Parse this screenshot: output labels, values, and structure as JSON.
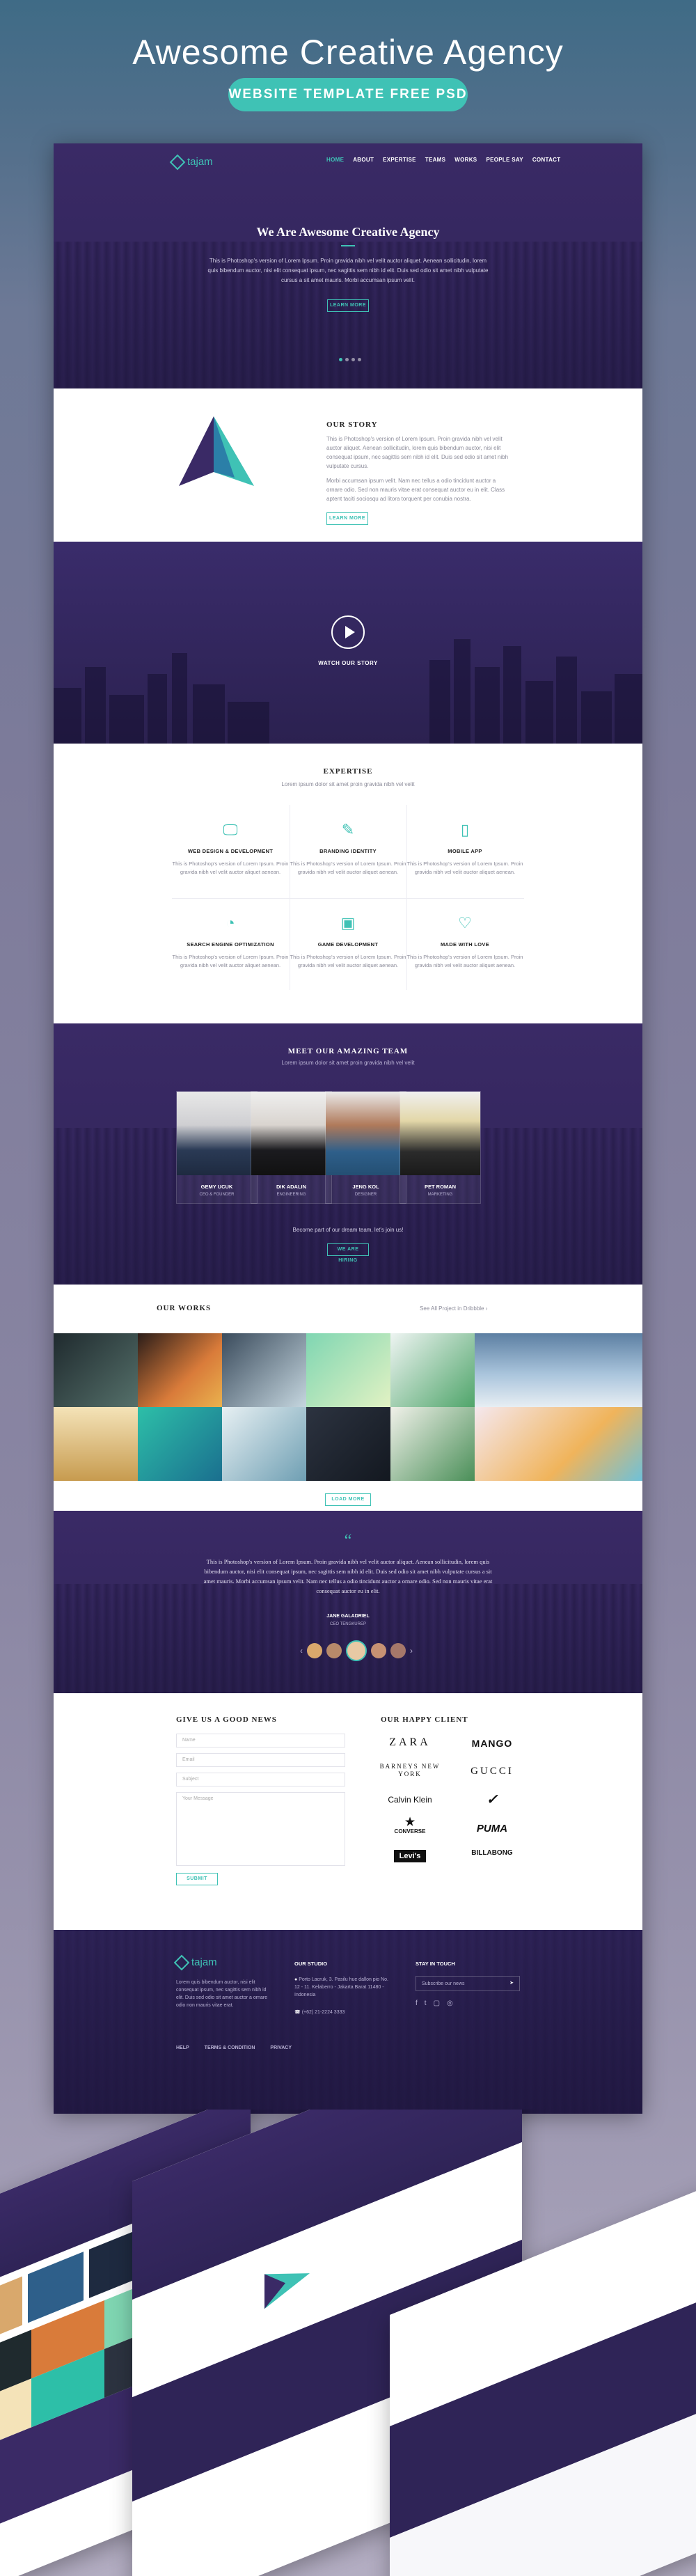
{
  "poster": {
    "title": "Awesome Creative Agency",
    "subtitle": "WEBSITE TEMPLATE FREE PSD"
  },
  "nav": {
    "logo": "tajam",
    "items": [
      "HOME",
      "ABOUT",
      "EXPERTISE",
      "TEAMS",
      "WORKS",
      "PEOPLE SAY",
      "CONTACT"
    ]
  },
  "hero": {
    "title": "We Are Awesome Creative Agency",
    "text": "This is Photoshop's version of Lorem Ipsum. Proin gravida nibh vel velit auctor aliquet. Aenean sollicitudin, lorem quis bibendum auctor, nisi elit consequat ipsum, nec sagittis sem nibh id elit. Duis sed odio sit amet nibh vulputate cursus a sit amet mauris. Morbi accumsan ipsum velit.",
    "button": "LEARN MORE"
  },
  "story": {
    "title": "OUR STORY",
    "p1": "This is Photoshop's version of Lorem Ipsum. Proin gravida nibh vel velit auctor aliquet. Aenean sollicitudin, lorem quis bibendum auctor, nisi elit consequat ipsum, nec sagittis sem nibh id elit. Duis sed odio sit amet nibh vulputate cursus.",
    "p2": "Morbi accumsan ipsum velit. Nam nec tellus a odio tincidunt auctor a ornare odio. Sed non mauris vitae erat consequat auctor eu in elit. Class aptent taciti sociosqu ad litora torquent per conubia nostra.",
    "button": "LEARN MORE"
  },
  "video": {
    "label": "WATCH OUR STORY"
  },
  "expertise": {
    "title": "EXPERTISE",
    "subtitle": "Lorem ipsum dolor sit amet proin gravida nibh vel velit",
    "items": [
      {
        "icon": "monitor-icon",
        "title": "WEB DESIGN & DEVELOPMENT",
        "text": "This is Photoshop's version of Lorem Ipsum. Proin gravida nibh vel velit auctor aliquet aenean."
      },
      {
        "icon": "brush-icon",
        "title": "BRANDING IDENTITY",
        "text": "This is Photoshop's version of Lorem Ipsum. Proin gravida nibh vel velit auctor aliquet aenean."
      },
      {
        "icon": "phone-icon",
        "title": "MOBILE APP",
        "text": "This is Photoshop's version of Lorem Ipsum. Proin gravida nibh vel velit auctor aliquet aenean."
      },
      {
        "icon": "pie-chart-icon",
        "title": "SEARCH ENGINE OPTIMIZATION",
        "text": "This is Photoshop's version of Lorem Ipsum. Proin gravida nibh vel velit auctor aliquet aenean."
      },
      {
        "icon": "gamepad-icon",
        "title": "GAME DEVELOPMENT",
        "text": "This is Photoshop's version of Lorem Ipsum. Proin gravida nibh vel velit auctor aliquet aenean."
      },
      {
        "icon": "heart-icon",
        "title": "MADE WITH LOVE",
        "text": "This is Photoshop's version of Lorem Ipsum. Proin gravida nibh vel velit auctor aliquet aenean."
      }
    ]
  },
  "team": {
    "title": "MEET OUR AMAZING TEAM",
    "subtitle": "Lorem ipsum dolor sit amet proin gravida nibh vel velit",
    "members": [
      {
        "name": "GEMY UCUK",
        "role": "CEO & FOUNDER"
      },
      {
        "name": "DIK ADALIN",
        "role": "ENGINEERING"
      },
      {
        "name": "JENG KOL",
        "role": "DESIGNER"
      },
      {
        "name": "PET ROMAN",
        "role": "MARKETING"
      }
    ],
    "cta_text": "Become part of our dream team, let's join us!",
    "cta_button": "WE ARE HIRING"
  },
  "works": {
    "title": "OUR WORKS",
    "link": "See All Project in Dribbble",
    "button": "LOAD MORE"
  },
  "testimonial": {
    "quote": "This is Photoshop's version of Lorem Ipsum. Proin gravida nibh vel velit auctor aliquet. Aenean sollicitudin, lorem quis bibendum auctor, nisi elit consequat ipsum, nec sagittis sem nibh id elit. Duis sed odio sit amet nibh vulputate cursus a sit amet mauris. Morbi accumsan ipsum velit. Nam nec tellus a odio tincidunt auctor a ornare odio. Sed non mauris vitae erat consequat auctor eu in elit.",
    "author": "JANE GALADRIEL",
    "author_role": "CEO TENGKUREP"
  },
  "contact": {
    "title": "GIVE US A GOOD NEWS",
    "name_placeholder": "Name",
    "email_placeholder": "Email",
    "subject_placeholder": "Subject",
    "message_placeholder": "Your Message",
    "submit": "SUBMIT"
  },
  "clients": {
    "title": "OUR HAPPY CLIENT",
    "logos": [
      "ZARA",
      "MANGO",
      "BARNEYS NEW YORK",
      "GUCCI",
      "Calvin Klein",
      "NIKE",
      "CONVERSE",
      "PUMA",
      "Levi's",
      "BILLABONG"
    ]
  },
  "footer": {
    "logo": "tajam",
    "about": "Lorem quis bibendum auctor, nisi elit consequat ipsum, nec sagittis sem nibh id elit. Duis sed odio sit amet auctor a ornare odio non mauris vitae erat.",
    "studio_title": "OUR STUDIO",
    "address": "Porto Lacruk, 3. Pasilu hue dallon pio No. 12 - 11. Kelaberro - Jakarta Barat 11480 - Indonesia",
    "phone": "(+62) 21-2224 3333",
    "touch_title": "STAY IN TOUCH",
    "subscribe_placeholder": "Subscribe our news",
    "links": [
      "HELP",
      "TERMS & CONDITION",
      "PRIVACY"
    ]
  },
  "colors": {
    "accent": "#3fc2b5",
    "purple": "#3a2a66"
  }
}
